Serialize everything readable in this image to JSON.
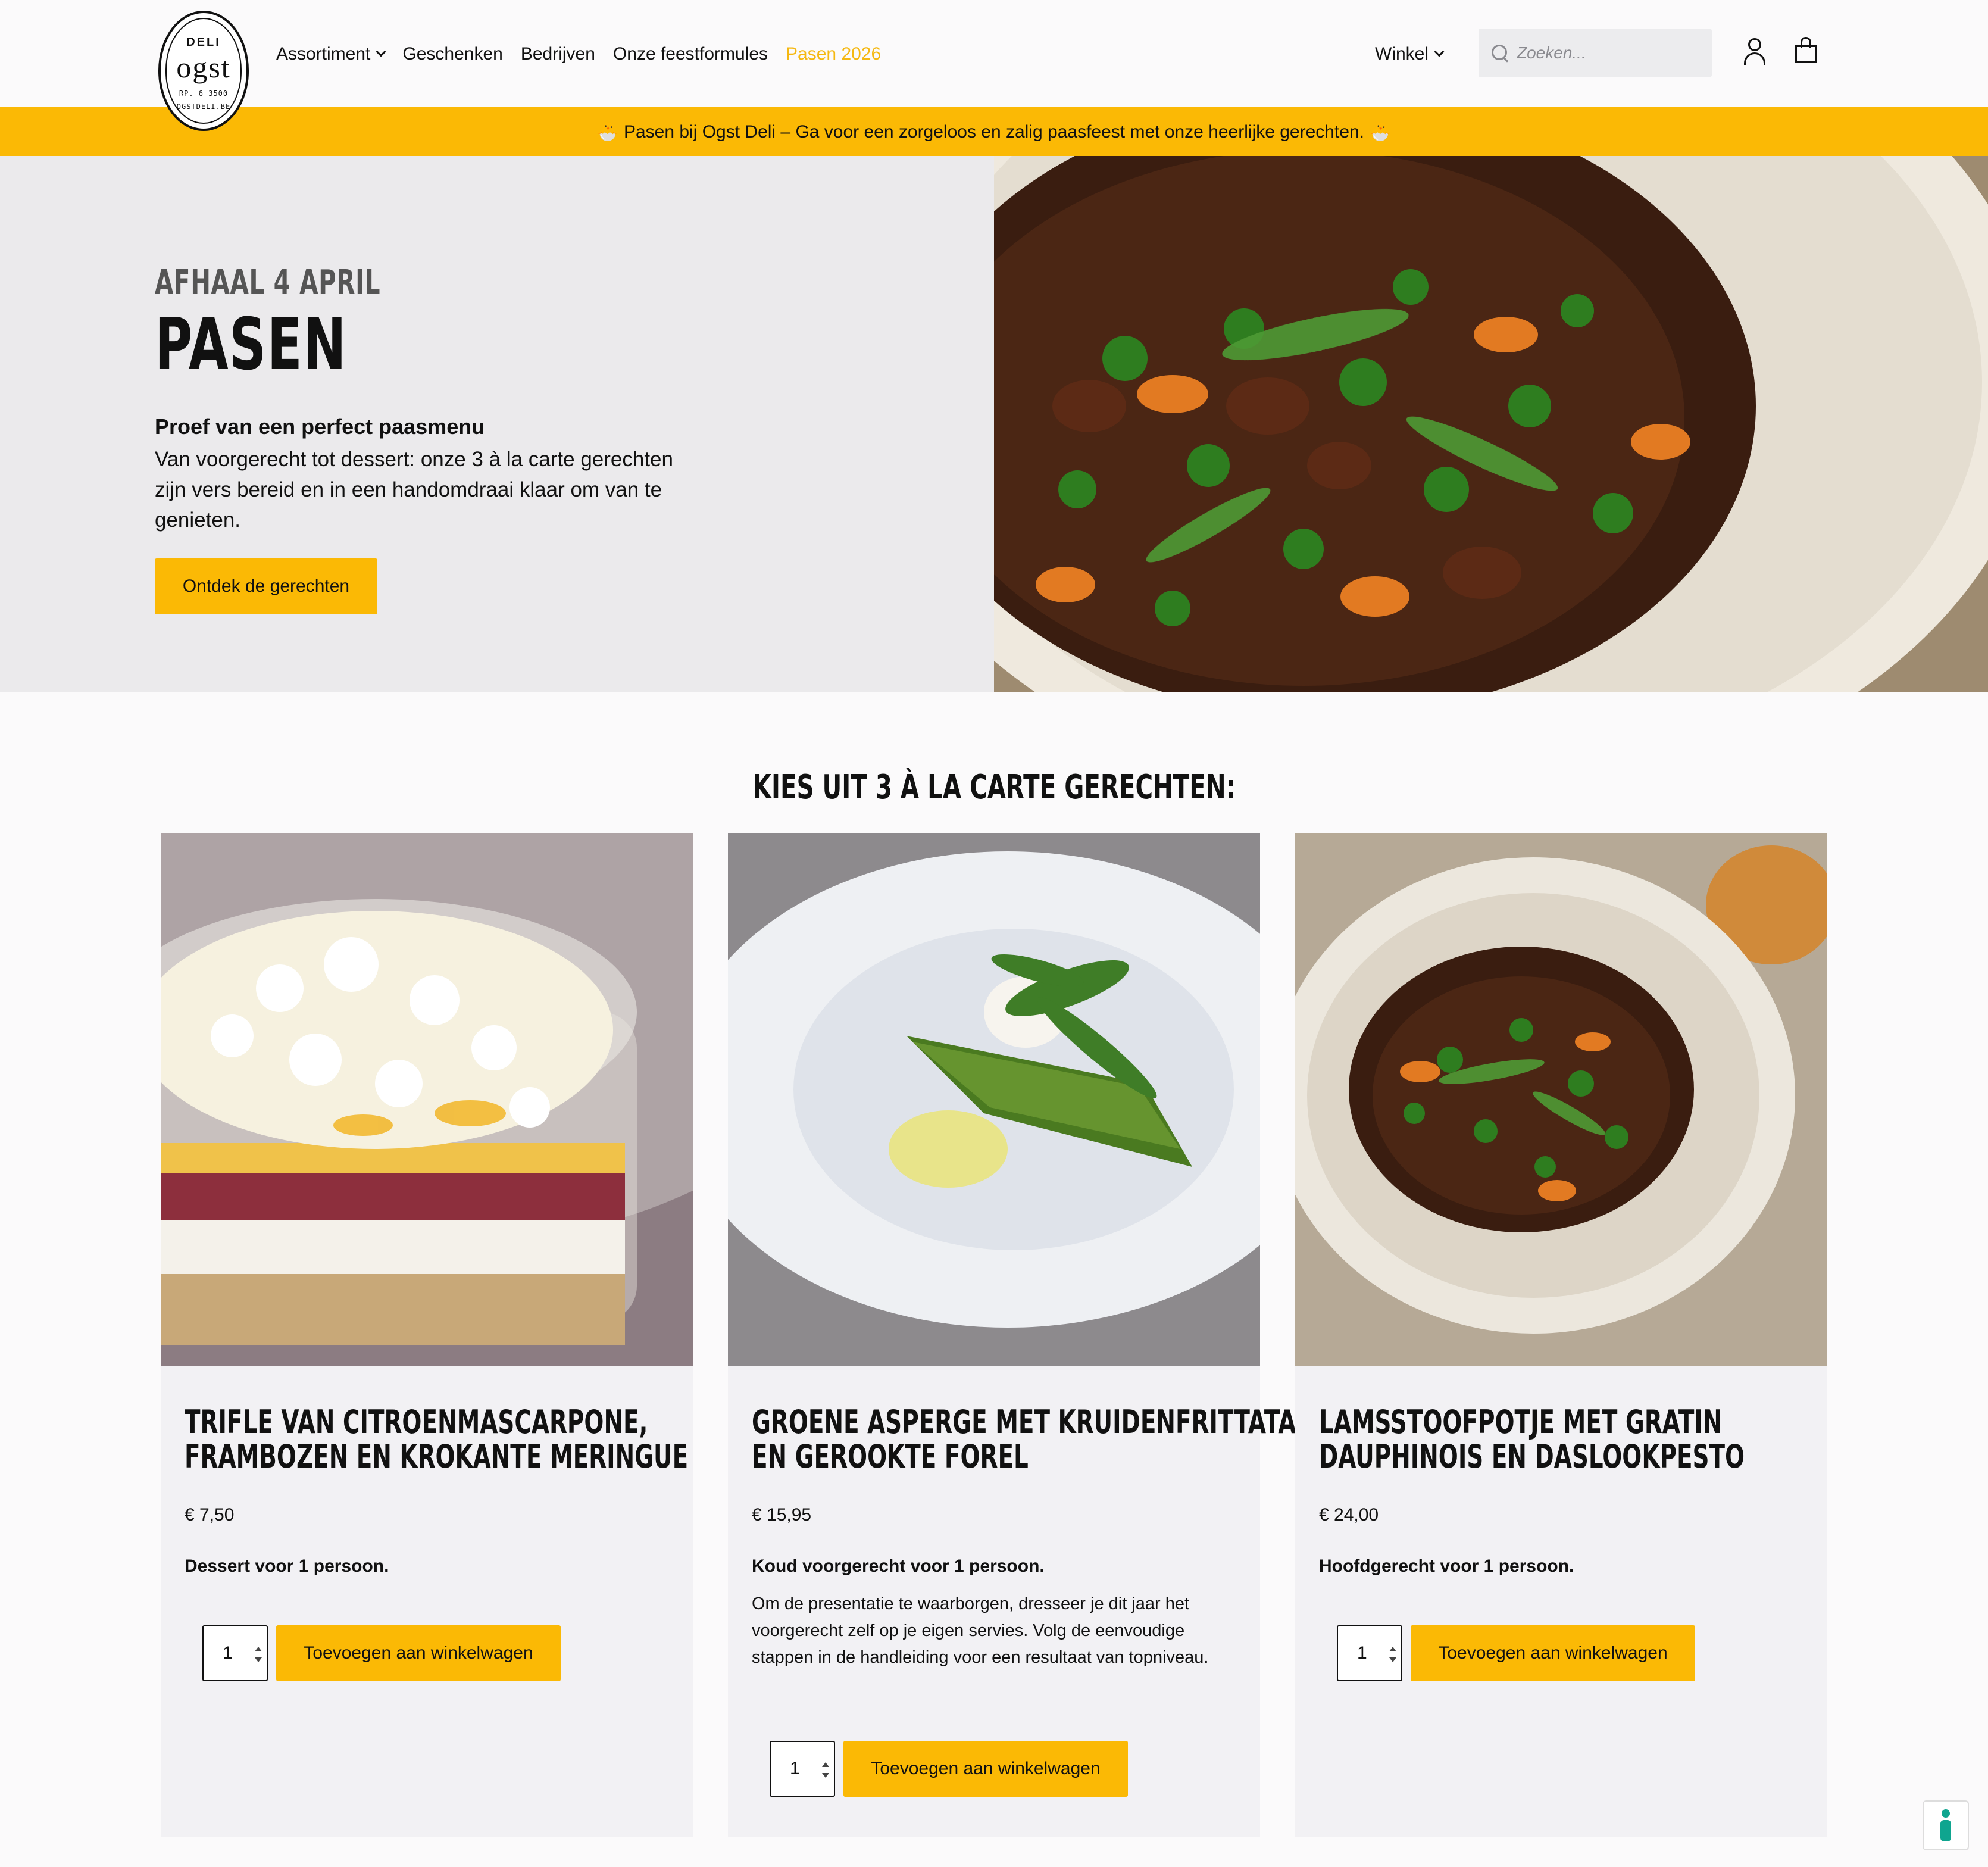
{
  "logo": {
    "line1": "DELI",
    "line2": "ogst",
    "line3": "RP. 6    3500",
    "line4": "OGSTDELI.BE"
  },
  "nav": {
    "items": [
      {
        "label": "Assortiment",
        "dropdown": true
      },
      {
        "label": "Geschenken"
      },
      {
        "label": "Bedrijven"
      },
      {
        "label": "Onze feestformules"
      },
      {
        "label": "Pasen 2026",
        "active": true
      }
    ],
    "store_label": "Winkel",
    "search_placeholder": "Zoeken..."
  },
  "banner": {
    "text": "🐣 Pasen bij Ogst Deli – Ga voor een zorgeloos en zalig paasfeest met onze heerlijke gerechten. 🐣"
  },
  "hero": {
    "kicker": "AFHAAL 4 APRIL",
    "title": "PASEN",
    "subtitle": "Proef van een perfect paasmenu",
    "text": "Van voorgerecht tot dessert: onze 3 à la carte gerechten zijn vers bereid en in een handomdraai klaar om van te genieten.",
    "button": "Ontdek de gerechten"
  },
  "section": {
    "title": "KIES UIT 3 À LA CARTE GERECHTEN:"
  },
  "products": [
    {
      "title_line1": "TRIFLE VAN CITROENMASCARPONE,",
      "title_line2": "FRAMBOZEN EN KROKANTE MERINGUE",
      "price": "€ 7,50",
      "description": "Dessert voor 1 persoon.",
      "extra": "",
      "quantity": "1",
      "button": "Toevoegen aan winkelwagen"
    },
    {
      "title_line1": "GROENE ASPERGE MET KRUIDENFRITTATA",
      "title_line2": "EN GEROOKTE FOREL",
      "price": "€ 15,95",
      "description": "Koud voorgerecht voor 1 persoon.",
      "extra": "Om de presentatie te waarborgen, dresseer je dit jaar het voorgerecht zelf op je eigen servies. Volg de eenvoudige stappen in de handleiding voor een resultaat van topniveau.",
      "quantity": "1",
      "button": "Toevoegen aan winkelwagen"
    },
    {
      "title_line1": "LAMSSTOOFPOTJE MET GRATIN",
      "title_line2": "DAUPHINOIS EN DASLOOKPESTO",
      "price": "€ 24,00",
      "description": "Hoofdgerecht voor 1 persoon.",
      "extra": "",
      "quantity": "1",
      "button": "Toevoegen aan winkelwagen"
    }
  ],
  "colors": {
    "accent": "#fbb905",
    "nav_active": "#f5b811",
    "hero_bg": "#ebeaec",
    "card_bg": "#f2f1f4"
  }
}
